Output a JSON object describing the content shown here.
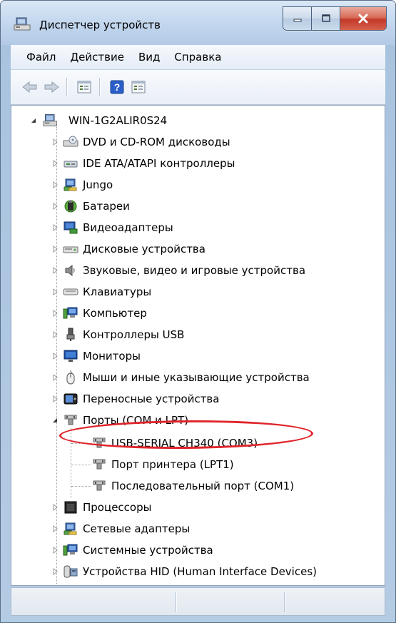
{
  "window": {
    "title": "Диспетчер устройств"
  },
  "menu": {
    "items": [
      "Файл",
      "Действие",
      "Вид",
      "Справка"
    ]
  },
  "toolbar": {
    "buttons": [
      "back-icon",
      "forward-icon",
      "properties-icon",
      "help-icon",
      "update-driver-icon"
    ]
  },
  "tree": {
    "root": "WIN-1G2ALIR0S24",
    "categories": [
      {
        "label": "DVD и CD-ROM дисководы",
        "icon": "dvd-drive-icon"
      },
      {
        "label": "IDE ATA/ATAPI контроллеры",
        "icon": "ide-controller-icon"
      },
      {
        "label": "Jungo",
        "icon": "jungo-icon"
      },
      {
        "label": "Батареи",
        "icon": "battery-icon"
      },
      {
        "label": "Видеоадаптеры",
        "icon": "display-adapter-icon"
      },
      {
        "label": "Дисковые устройства",
        "icon": "disk-drive-icon"
      },
      {
        "label": "Звуковые, видео и игровые устройства",
        "icon": "sound-icon"
      },
      {
        "label": "Клавиатуры",
        "icon": "keyboard-icon"
      },
      {
        "label": "Компьютер",
        "icon": "computer-icon"
      },
      {
        "label": "Контроллеры USB",
        "icon": "usb-icon"
      },
      {
        "label": "Мониторы",
        "icon": "monitor-icon"
      },
      {
        "label": "Мыши и иные указывающие устройства",
        "icon": "mouse-icon"
      },
      {
        "label": "Переносные устройства",
        "icon": "portable-device-icon"
      },
      {
        "label": "Порты (COM и LPT)",
        "icon": "port-icon",
        "expanded": true
      },
      {
        "label": "Процессоры",
        "icon": "processor-icon"
      },
      {
        "label": "Сетевые адаптеры",
        "icon": "network-adapter-icon"
      },
      {
        "label": "Системные устройства",
        "icon": "system-device-icon"
      },
      {
        "label": "Устройства HID (Human Interface Devices)",
        "icon": "hid-icon"
      }
    ],
    "ports_children": [
      {
        "label": "USB-SERIAL CH340 (COM3)",
        "highlighted": true
      },
      {
        "label": "Порт принтера (LPT1)"
      },
      {
        "label": "Последовательный порт (COM1)"
      }
    ]
  },
  "colors": {
    "highlight_ellipse": "#e0242a",
    "titlebar": "#c3d7ee",
    "close_button": "#c4392a"
  }
}
